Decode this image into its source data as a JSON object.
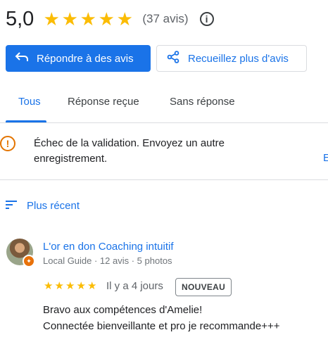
{
  "rating": {
    "score": "5,0",
    "stars": 5,
    "count_text": "(37 avis)"
  },
  "actions": {
    "reply_label": "Répondre à des avis",
    "collect_label": "Recueillez plus d'avis"
  },
  "tabs": [
    {
      "label": "Tous",
      "active": true
    },
    {
      "label": "Réponse reçue",
      "active": false
    },
    {
      "label": "Sans réponse",
      "active": false
    }
  ],
  "alert": {
    "text": "Échec de la validation. Envoyez un autre enregistrement.",
    "edge_text": "E"
  },
  "sort": {
    "label": "Plus récent"
  },
  "review": {
    "author": "L'or en don Coaching intuitif",
    "meta": "Local Guide · 12 avis · 5 photos",
    "stars": 5,
    "time": "Il y a 4 jours",
    "badge": "NOUVEAU",
    "text_line1": "Bravo aux compétences d'Amelie!",
    "text_line2": "Connectée bienveillante et pro je recommande+++"
  },
  "colors": {
    "accent": "#1a73e8",
    "star": "#fbbc04",
    "warning": "#e37400"
  },
  "icons": [
    "star-icon",
    "info-icon",
    "reply-icon",
    "share-icon",
    "warning-icon",
    "sort-icon",
    "local-guide-badge-icon"
  ]
}
